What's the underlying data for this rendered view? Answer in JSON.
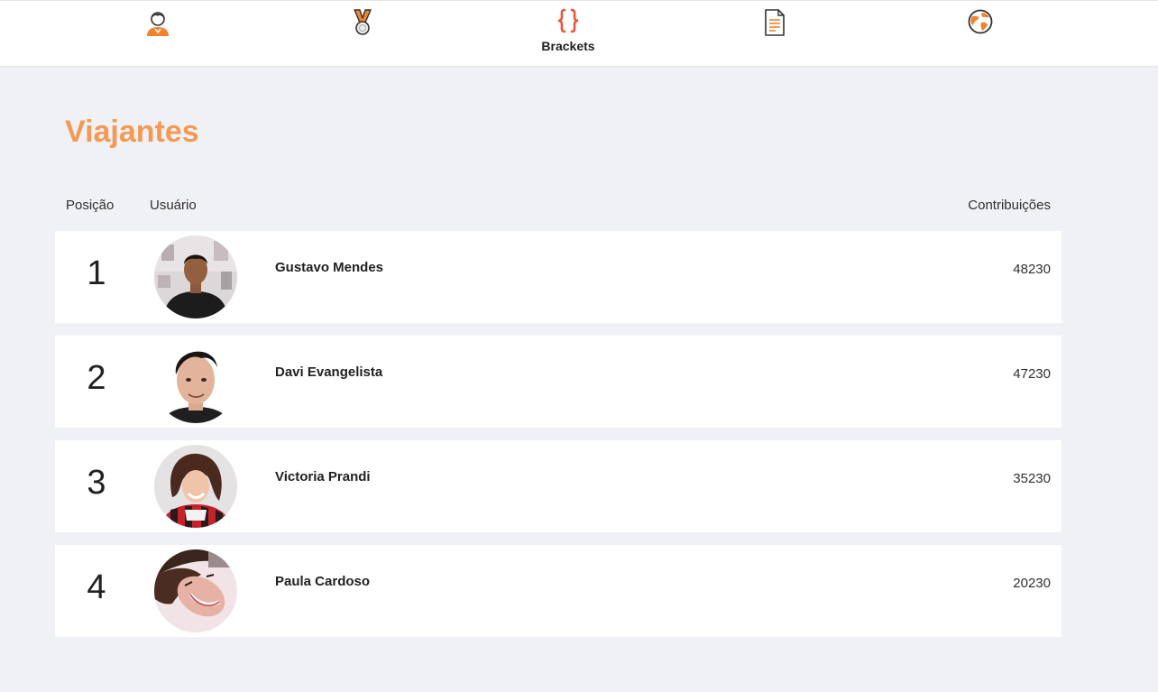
{
  "nav": {
    "items": [
      {
        "name": "nav-item-profile",
        "icon": "user-avatar-icon",
        "label": ""
      },
      {
        "name": "nav-item-medals",
        "icon": "medal-icon",
        "label": ""
      },
      {
        "name": "nav-item-brackets",
        "icon": "curly-braces-icon",
        "label": "Brackets",
        "active": true
      },
      {
        "name": "nav-item-documents",
        "icon": "document-icon",
        "label": ""
      },
      {
        "name": "nav-item-globe",
        "icon": "globe-icon",
        "label": ""
      }
    ]
  },
  "colors": {
    "accent": "#f39a54",
    "brackets_icon": "#e8553a",
    "background": "#f0f1f5"
  },
  "page": {
    "title": "Viajantes"
  },
  "table": {
    "headers": {
      "position": "Posição",
      "user": "Usuário",
      "contributions": "Contribuições"
    },
    "rows": [
      {
        "position": "1",
        "name": "Gustavo Mendes",
        "contributions": "48230"
      },
      {
        "position": "2",
        "name": "Davi Evangelista",
        "contributions": "47230"
      },
      {
        "position": "3",
        "name": "Victoria Prandi",
        "contributions": "35230"
      },
      {
        "position": "4",
        "name": "Paula Cardoso",
        "contributions": "20230"
      }
    ]
  }
}
